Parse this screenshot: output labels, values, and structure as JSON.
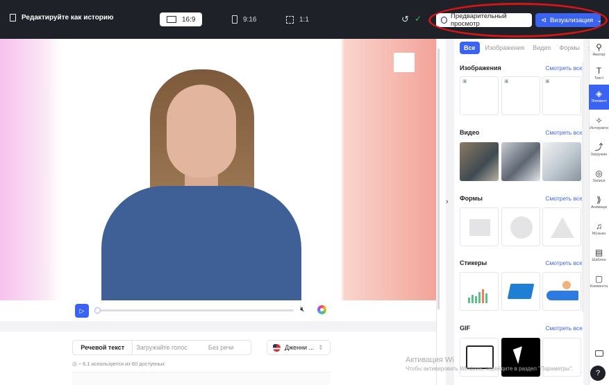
{
  "header": {
    "title": "Редактируйте как историю",
    "ratios": [
      "16:9",
      "9:16",
      "1:1"
    ],
    "preview_label": "Предварительный просмотр",
    "visualize_label": "Визуализация"
  },
  "script_panel": {
    "tabs": [
      "Речевой текст",
      "Загружайте голос",
      "Без речи"
    ],
    "voice": "Дженни ...",
    "usage": "~ 6.1 используется из 60 доступных"
  },
  "media": {
    "tabs": [
      "Все",
      "Изображения",
      "Видео",
      "Формы"
    ],
    "see_all": "Смотреть все",
    "sections": {
      "images": "Изображения",
      "video": "Видео",
      "shapes": "Формы",
      "stickers": "Стикеры",
      "gif": "GIF"
    }
  },
  "rail": {
    "avatar": "Аватар",
    "text": "Текст",
    "elements": "Элемент",
    "interactive": "Интеракти",
    "uploads": "Загружае",
    "records": "Записи",
    "animation": "Анимаци",
    "music": "Музыка",
    "templates": "Шаблон",
    "comments": "Коммента"
  },
  "watermark": {
    "line1": "Активация Wi",
    "line2": "Чтобы активировать Windows, перейдите в раздел \"Параметры\"."
  },
  "colors": {
    "accent": "#3b63f2",
    "topbar": "#1f2128",
    "highlight": "#d41616"
  }
}
